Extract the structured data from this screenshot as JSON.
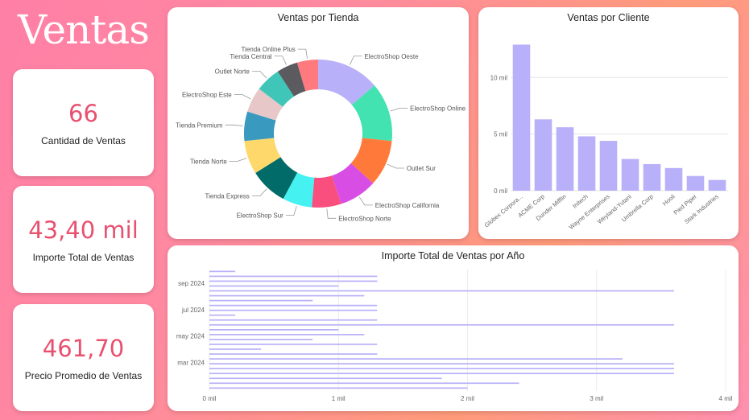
{
  "page_title": "Ventas",
  "kpis": {
    "cantidad": {
      "value": "66",
      "label": "Cantidad de Ventas"
    },
    "importe": {
      "value": "43,40 mil",
      "label": "Importe Total de Ventas"
    },
    "precio": {
      "value": "461,70",
      "label": "Precio Promedio de Ventas"
    }
  },
  "colors": {
    "accent": "#e8506f",
    "bar": "#b8b0f8"
  },
  "chart_data": [
    {
      "type": "pie",
      "title": "Ventas por Tienda",
      "categories": [
        "ElectroShop Oeste",
        "ElectroShop Online",
        "Outlet Sur",
        "ElectroShop California",
        "ElectroShop Norte",
        "ElectroShop Sur",
        "Tienda Express",
        "Tienda Norte",
        "Tienda Premium",
        "ElectroShop Este",
        "Outlet Norte",
        "Tienda Central",
        "Tienda Online Plus"
      ],
      "values": [
        15,
        14,
        11,
        9,
        7,
        7,
        9,
        8,
        7,
        6,
        6,
        5,
        5
      ],
      "colors": [
        "#b8b0f8",
        "#42e3b0",
        "#ff7a3a",
        "#d84ee5",
        "#f94f7f",
        "#46f1f2",
        "#006b68",
        "#ffd86b",
        "#3a99be",
        "#e8c7c9",
        "#3fc6b8",
        "#5a5a5f",
        "#ff7a7f",
        "#f7d060"
      ]
    },
    {
      "type": "bar",
      "title": "Ventas por Cliente",
      "categories": [
        "Globex Corpora...",
        "ACME Corp",
        "Dunder Mifflin",
        "Initech",
        "Wayne Enterprises",
        "Weyland-Yutani",
        "Umbrella Corp",
        "Hooli",
        "Pied Piper",
        "Stark Industries"
      ],
      "values": [
        12900,
        6300,
        5600,
        4800,
        4400,
        2800,
        2350,
        2000,
        1300,
        950
      ],
      "y_ticks": [
        "0 mil",
        "5 mil",
        "10 mil"
      ],
      "y_tick_values": [
        0,
        5000,
        10000
      ],
      "ylim": [
        0,
        13500
      ]
    },
    {
      "type": "bar",
      "title": "Importe Total de Ventas por Año",
      "y_tick_labels": [
        "sep 2024",
        "jul 2024",
        "may 2024",
        "mar 2024"
      ],
      "x_ticks": [
        "0 mil",
        "1 mil",
        "2 mil",
        "3 mil",
        "4 mil"
      ],
      "x_tick_values": [
        0,
        1000,
        2000,
        3000,
        4000
      ],
      "xlim": [
        0,
        4000
      ],
      "values": [
        200,
        1300,
        1300,
        1000,
        3600,
        1200,
        800,
        1300,
        1300,
        200,
        1300,
        3600,
        1000,
        1200,
        800,
        1300,
        400,
        1300,
        3200,
        3600,
        3600,
        3600,
        1800,
        2400,
        2000
      ]
    }
  ]
}
